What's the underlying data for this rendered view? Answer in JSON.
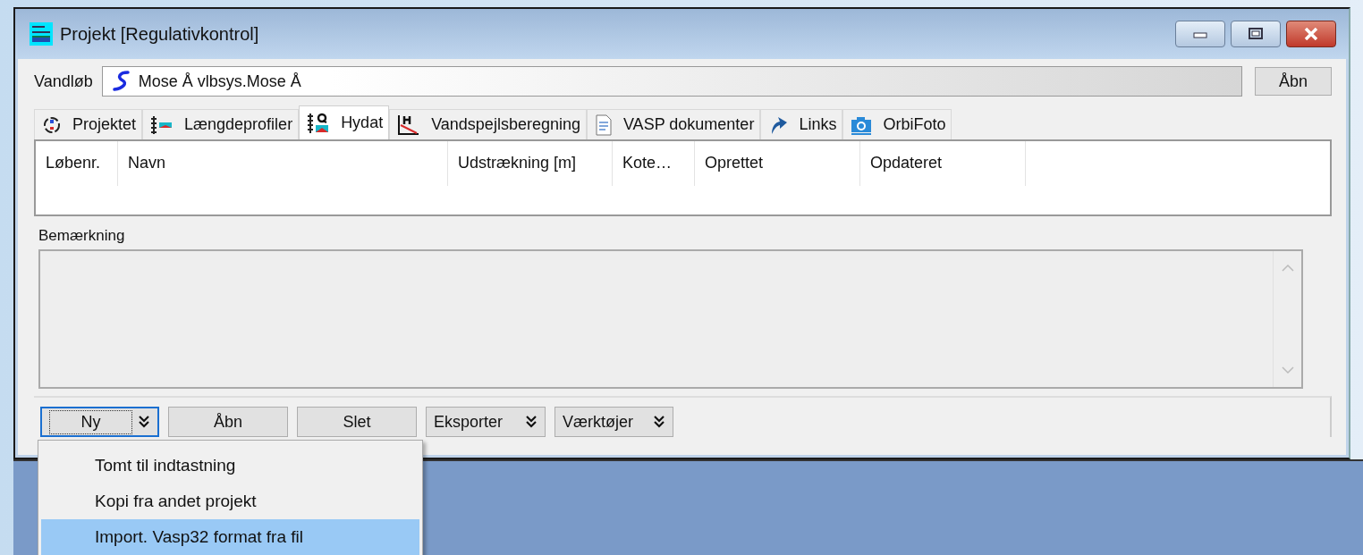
{
  "window": {
    "title": "Projekt [Regulativkontrol]"
  },
  "watercourse": {
    "label": "Vandløb",
    "value": "Mose Å vlbsys.Mose Å",
    "button": "Åbn"
  },
  "tabs": [
    {
      "label": "Projektet",
      "kind": "project",
      "selected": false
    },
    {
      "label": "Længdeprofiler",
      "kind": "profile",
      "selected": false
    },
    {
      "label": "Hydat",
      "kind": "hydat",
      "selected": true
    },
    {
      "label": "Vandspejlsberegning",
      "kind": "calc",
      "selected": false
    },
    {
      "label": "VASP dokumenter",
      "kind": "document",
      "selected": false
    },
    {
      "label": "Links",
      "kind": "link",
      "selected": false
    },
    {
      "label": "OrbiFoto",
      "kind": "camera",
      "selected": false
    }
  ],
  "table": {
    "columns": [
      "Løbenr.",
      "Navn",
      "Udstrækning [m]",
      "Kote…",
      "Oprettet",
      "Opdateret"
    ]
  },
  "remark": {
    "label": "Bemærkning"
  },
  "toolbar": [
    {
      "label": "Ny",
      "dropdown": true,
      "focused": true
    },
    {
      "label": "Åbn",
      "dropdown": false,
      "focused": false
    },
    {
      "label": "Slet",
      "dropdown": false,
      "focused": false
    },
    {
      "label": "Eksporter",
      "dropdown": true,
      "focused": false
    },
    {
      "label": "Værktøjer",
      "dropdown": true,
      "focused": false
    }
  ],
  "menu": {
    "items": [
      {
        "label": "Tomt til indtastning",
        "selected": false
      },
      {
        "label": "Kopi fra andet projekt",
        "selected": false
      },
      {
        "label": "Import. Vasp32 format fra fil",
        "selected": true
      }
    ]
  }
}
